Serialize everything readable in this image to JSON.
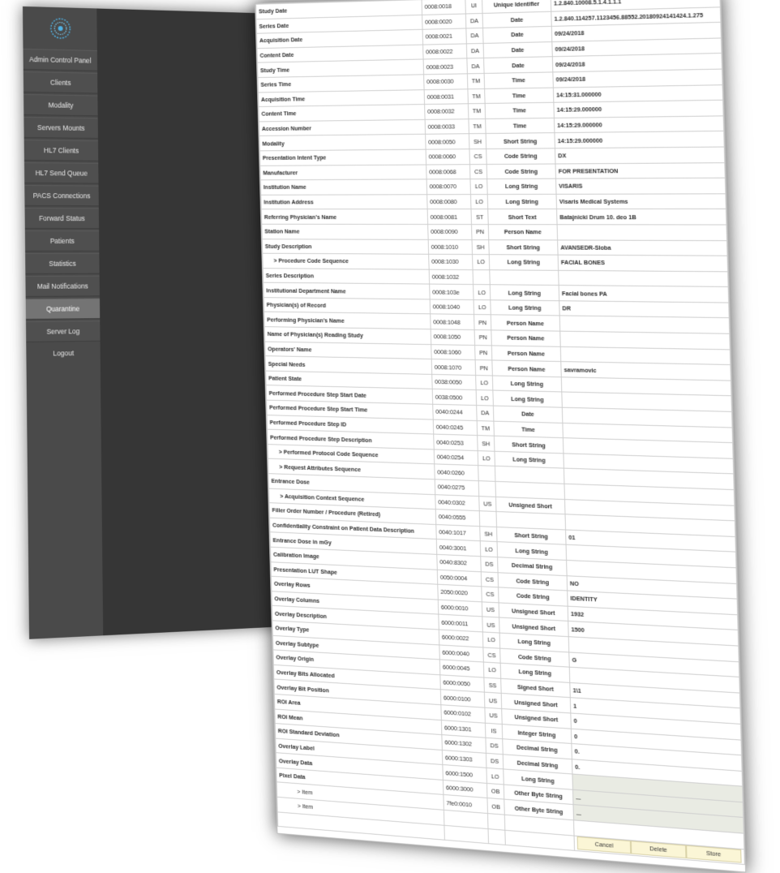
{
  "sidebar": {
    "items": [
      {
        "label": "Admin Control Panel",
        "active": false
      },
      {
        "label": "Clients",
        "active": false
      },
      {
        "label": "Modality",
        "active": false
      },
      {
        "label": "Servers Mounts",
        "active": false
      },
      {
        "label": "HL7 Clients",
        "active": false
      },
      {
        "label": "HL7 Send Queue",
        "active": false
      },
      {
        "label": "PACS Connections",
        "active": false
      },
      {
        "label": "Forward Status",
        "active": false
      },
      {
        "label": "Patients",
        "active": false
      },
      {
        "label": "Statistics",
        "active": false
      },
      {
        "label": "Mail Notifications",
        "active": false
      },
      {
        "label": "Quarantine",
        "active": true
      },
      {
        "label": "Server Log",
        "active": false
      },
      {
        "label": "Logout",
        "active": false
      }
    ]
  },
  "table": {
    "rows": [
      {
        "name": "Study Date",
        "tag": "0008:0018",
        "vr": "UI",
        "vr_name": "Unique Identifier",
        "value": "1.2.840.10008.5.1.4.1.1.1"
      },
      {
        "name": "Series Date",
        "tag": "0008:0020",
        "vr": "DA",
        "vr_name": "Date",
        "value": "1.2.840.114257.1123456.88552.20180924141424.1.275"
      },
      {
        "name": "Acquisition Date",
        "tag": "0008:0021",
        "vr": "DA",
        "vr_name": "Date",
        "value": "09/24/2018"
      },
      {
        "name": "Content Date",
        "tag": "0008:0022",
        "vr": "DA",
        "vr_name": "Date",
        "value": "09/24/2018"
      },
      {
        "name": "Study Time",
        "tag": "0008:0023",
        "vr": "DA",
        "vr_name": "Date",
        "value": "09/24/2018"
      },
      {
        "name": "Series Time",
        "tag": "0008:0030",
        "vr": "TM",
        "vr_name": "Time",
        "value": "09/24/2018"
      },
      {
        "name": "Acquisition Time",
        "tag": "0008:0031",
        "vr": "TM",
        "vr_name": "Time",
        "value": "14:15:31.000000"
      },
      {
        "name": "Content Time",
        "tag": "0008:0032",
        "vr": "TM",
        "vr_name": "Time",
        "value": "14:15:29.000000"
      },
      {
        "name": "Accession Number",
        "tag": "0008:0033",
        "vr": "TM",
        "vr_name": "Time",
        "value": "14:15:29.000000"
      },
      {
        "name": "Modality",
        "tag": "0008:0050",
        "vr": "SH",
        "vr_name": "Short String",
        "value": "14:15:29.000000"
      },
      {
        "name": "Presentation Intent Type",
        "tag": "0008:0060",
        "vr": "CS",
        "vr_name": "Code String",
        "value": "DX"
      },
      {
        "name": "Manufacturer",
        "tag": "0008:0068",
        "vr": "CS",
        "vr_name": "Code String",
        "value": "FOR PRESENTATION"
      },
      {
        "name": "Institution Name",
        "tag": "0008:0070",
        "vr": "LO",
        "vr_name": "Long String",
        "value": "VISARIS"
      },
      {
        "name": "Institution Address",
        "tag": "0008:0080",
        "vr": "LO",
        "vr_name": "Long String",
        "value": "Visaris Medical Systems"
      },
      {
        "name": "Referring Physician's Name",
        "tag": "0008:0081",
        "vr": "ST",
        "vr_name": "Short Text",
        "value": "Batajnicki Drum 10. deo 1B"
      },
      {
        "name": "Station Name",
        "tag": "0008:0090",
        "vr": "PN",
        "vr_name": "Person Name",
        "value": ""
      },
      {
        "name": "Study Description",
        "tag": "0008:1010",
        "vr": "SH",
        "vr_name": "Short String",
        "value": "AVANSEDR-Sloba"
      },
      {
        "name": "> Procedure Code Sequence",
        "tag": "0008:1030",
        "vr": "LO",
        "vr_name": "Long String",
        "value": "FACIAL BONES",
        "indent": 1
      },
      {
        "name": "Series Description",
        "tag": "0008:1032",
        "vr": "",
        "vr_name": "",
        "value": ""
      },
      {
        "name": "Institutional Department Name",
        "tag": "0008:103e",
        "vr": "LO",
        "vr_name": "Long String",
        "value": "Facial bones PA"
      },
      {
        "name": "Physician(s) of Record",
        "tag": "0008:1040",
        "vr": "LO",
        "vr_name": "Long String",
        "value": "DR"
      },
      {
        "name": "Performing Physician's Name",
        "tag": "0008:1048",
        "vr": "PN",
        "vr_name": "Person Name",
        "value": ""
      },
      {
        "name": "Name of Physician(s) Reading Study",
        "tag": "0008:1050",
        "vr": "PN",
        "vr_name": "Person Name",
        "value": ""
      },
      {
        "name": "Operators' Name",
        "tag": "0008:1060",
        "vr": "PN",
        "vr_name": "Person Name",
        "value": ""
      },
      {
        "name": "Special Needs",
        "tag": "0008:1070",
        "vr": "PN",
        "vr_name": "Person Name",
        "value": "savramovic"
      },
      {
        "name": "Patient State",
        "tag": "0038:0050",
        "vr": "LO",
        "vr_name": "Long String",
        "value": ""
      },
      {
        "name": "Performed Procedure Step Start Date",
        "tag": "0038:0500",
        "vr": "LO",
        "vr_name": "Long String",
        "value": ""
      },
      {
        "name": "Performed Procedure Step Start Time",
        "tag": "0040:0244",
        "vr": "DA",
        "vr_name": "Date",
        "value": ""
      },
      {
        "name": "Performed Procedure Step ID",
        "tag": "0040:0245",
        "vr": "TM",
        "vr_name": "Time",
        "value": ""
      },
      {
        "name": "Performed Procedure Step Description",
        "tag": "0040:0253",
        "vr": "SH",
        "vr_name": "Short String",
        "value": ""
      },
      {
        "name": "> Performed Protocol Code Sequence",
        "tag": "0040:0254",
        "vr": "LO",
        "vr_name": "Long String",
        "value": "",
        "indent": 1
      },
      {
        "name": "> Request Attributes Sequence",
        "tag": "0040:0260",
        "vr": "",
        "vr_name": "",
        "value": "",
        "indent": 1
      },
      {
        "name": "Entrance Dose",
        "tag": "0040:0275",
        "vr": "",
        "vr_name": "",
        "value": ""
      },
      {
        "name": "> Acquisition Context Sequence",
        "tag": "0040:0302",
        "vr": "US",
        "vr_name": "Unsigned Short",
        "value": "",
        "indent": 1
      },
      {
        "name": "Filler Order Number / Procedure (Retired)",
        "tag": "0040:0555",
        "vr": "",
        "vr_name": "",
        "value": ""
      },
      {
        "name": "Confidentiality Constraint on Patient Data Description",
        "tag": "0040:1017",
        "vr": "SH",
        "vr_name": "Short String",
        "value": "01"
      },
      {
        "name": "Entrance Dose in mGy",
        "tag": "0040:3001",
        "vr": "LO",
        "vr_name": "Long String",
        "value": ""
      },
      {
        "name": "Calibration Image",
        "tag": "0040:8302",
        "vr": "DS",
        "vr_name": "Decimal String",
        "value": ""
      },
      {
        "name": "Presentation LUT Shape",
        "tag": "0050:0004",
        "vr": "CS",
        "vr_name": "Code String",
        "value": "NO"
      },
      {
        "name": "Overlay Rows",
        "tag": "2050:0020",
        "vr": "CS",
        "vr_name": "Code String",
        "value": "IDENTITY"
      },
      {
        "name": "Overlay Columns",
        "tag": "6000:0010",
        "vr": "US",
        "vr_name": "Unsigned Short",
        "value": "1932"
      },
      {
        "name": "Overlay Description",
        "tag": "6000:0011",
        "vr": "US",
        "vr_name": "Unsigned Short",
        "value": "1500"
      },
      {
        "name": "Overlay Type",
        "tag": "6000:0022",
        "vr": "LO",
        "vr_name": "Long String",
        "value": ""
      },
      {
        "name": "Overlay Subtype",
        "tag": "6000:0040",
        "vr": "CS",
        "vr_name": "Code String",
        "value": "G"
      },
      {
        "name": "Overlay Origin",
        "tag": "6000:0045",
        "vr": "LO",
        "vr_name": "Long String",
        "value": ""
      },
      {
        "name": "Overlay Bits Allocated",
        "tag": "6000:0050",
        "vr": "SS",
        "vr_name": "Signed Short",
        "value": "1\\1"
      },
      {
        "name": "Overlay Bit Position",
        "tag": "6000:0100",
        "vr": "US",
        "vr_name": "Unsigned Short",
        "value": "1"
      },
      {
        "name": "ROI Area",
        "tag": "6000:0102",
        "vr": "US",
        "vr_name": "Unsigned Short",
        "value": "0"
      },
      {
        "name": "ROI Mean",
        "tag": "6000:1301",
        "vr": "IS",
        "vr_name": "Integer String",
        "value": "0"
      },
      {
        "name": "ROI Standard Deviation",
        "tag": "6000:1302",
        "vr": "DS",
        "vr_name": "Decimal String",
        "value": "0."
      },
      {
        "name": "Overlay Label",
        "tag": "6000:1303",
        "vr": "DS",
        "vr_name": "Decimal String",
        "value": "0."
      },
      {
        "name": "Overlay Data",
        "tag": "6000:1500",
        "vr": "LO",
        "vr_name": "Long String",
        "value": "",
        "tinted": true
      },
      {
        "name": "Pixel Data",
        "tag": "6000:3000",
        "vr": "OB",
        "vr_name": "Other Byte String",
        "value": "...",
        "tinted": true
      },
      {
        "name": "> Item",
        "tag": "7fe0:0010",
        "vr": "OB",
        "vr_name": "Other Byte String",
        "value": "...",
        "indent": 2,
        "tinted": true
      },
      {
        "name": "> Item",
        "tag": "",
        "vr": "",
        "vr_name": "",
        "value": "",
        "indent": 2
      }
    ]
  },
  "buttons": {
    "cancel": "Cancel",
    "delete": "Delete",
    "store": "Store"
  }
}
